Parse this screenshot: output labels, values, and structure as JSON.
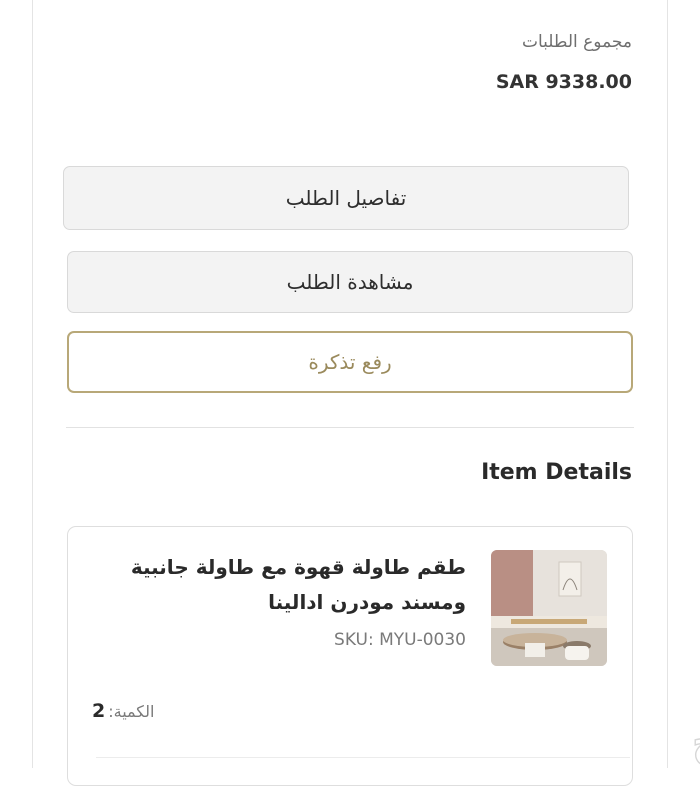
{
  "orders_total": {
    "label": "مجموع الطلبات",
    "value": "SAR 9338.00"
  },
  "buttons": {
    "order_details": "تفاصيل الطلب",
    "view_order": "مشاهدة الطلب",
    "raise_ticket": "رفع تذكرة"
  },
  "item_details": {
    "title": "Item Details",
    "item": {
      "name": "طقم طاولة قهوة مع طاولة جانبية ومسند مودرن ادالينا",
      "sku": "SKU: MYU-0030",
      "quantity_label": "الكمية:",
      "quantity": "2",
      "image_icon": "product-photo"
    }
  },
  "watermark": {
    "text": "حراج"
  }
}
